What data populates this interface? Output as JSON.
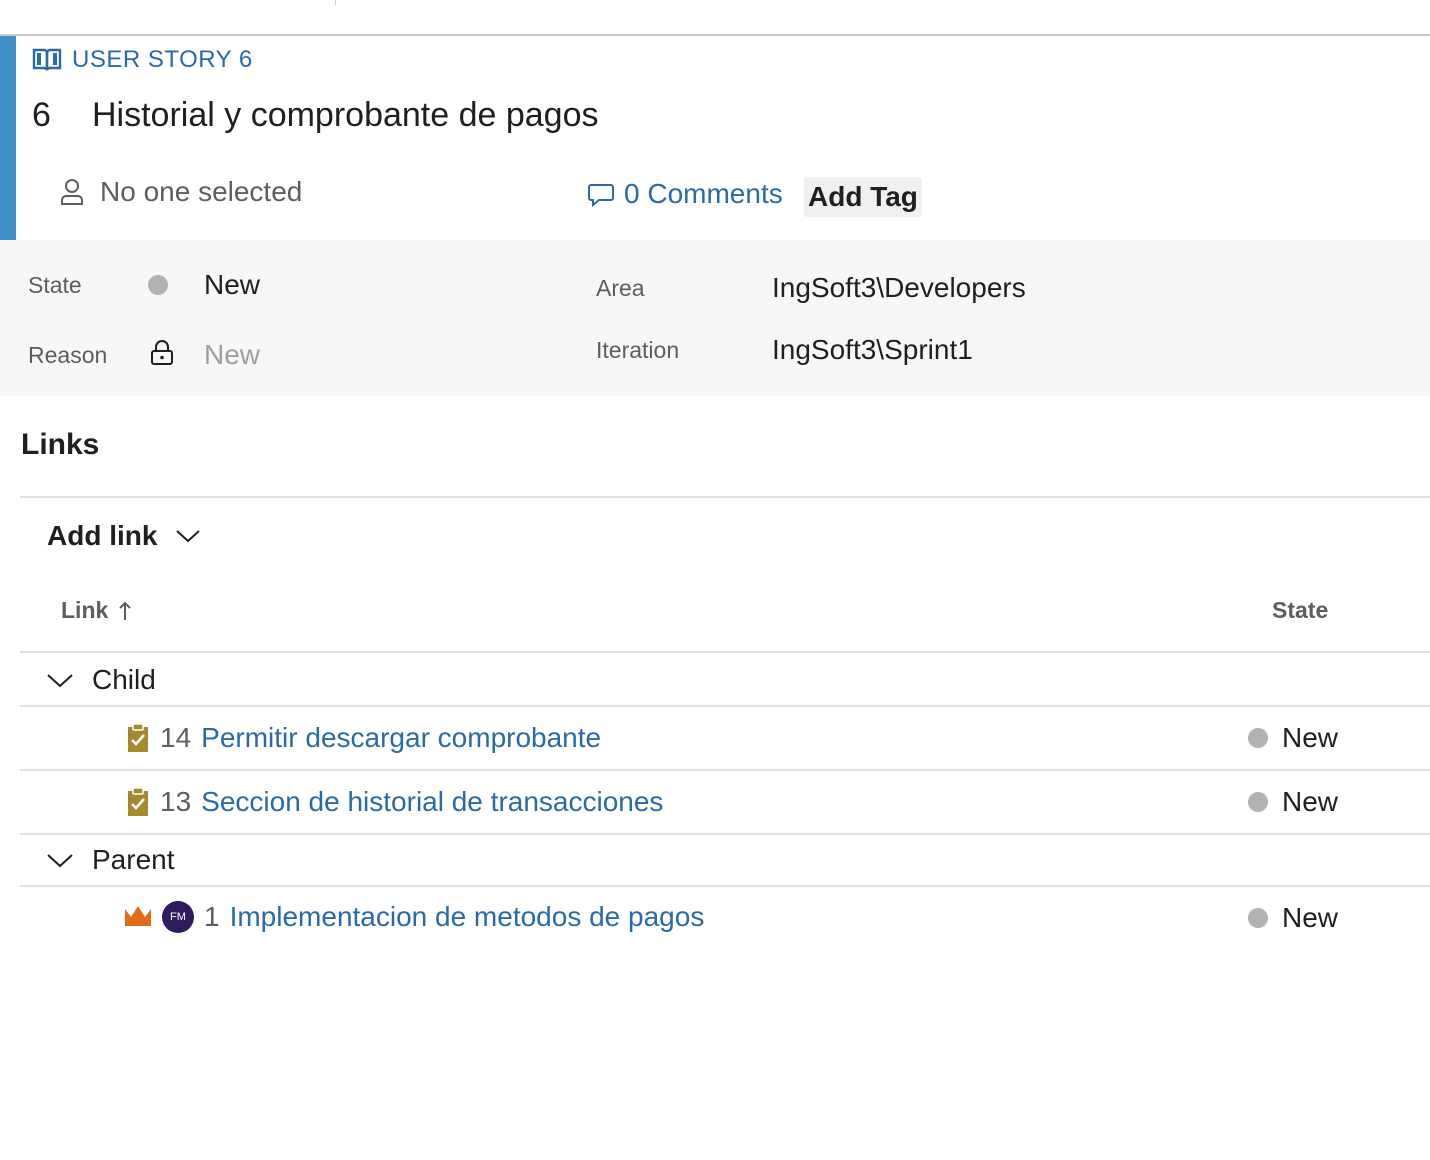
{
  "work_item": {
    "type_label": "USER STORY 6",
    "id": "6",
    "title": "Historial y comprobante de pagos",
    "assigned_to": "No one selected",
    "comments_label": "0 Comments",
    "add_tag_label": "Add Tag",
    "accent_color": "#3d8fc6"
  },
  "fields": {
    "state_label": "State",
    "state_value": "New",
    "reason_label": "Reason",
    "reason_value": "New",
    "area_label": "Area",
    "area_value": "IngSoft3\\Developers",
    "iteration_label": "Iteration",
    "iteration_value": "IngSoft3\\Sprint1"
  },
  "links": {
    "section_title": "Links",
    "add_link_label": "Add link",
    "col_link": "Link",
    "col_state": "State",
    "groups": [
      {
        "label": "Child",
        "items": [
          {
            "id": "14",
            "title": "Permitir descargar comprobante",
            "state": "New",
            "icon": "task-clipboard-icon"
          },
          {
            "id": "13",
            "title": "Seccion de historial de transacciones",
            "state": "New",
            "icon": "task-clipboard-icon"
          }
        ]
      },
      {
        "label": "Parent",
        "items": [
          {
            "id": "1",
            "title": "Implementacion de metodos de pagos",
            "state": "New",
            "icon": "epic-crown-icon",
            "avatar": "FM"
          }
        ]
      }
    ]
  }
}
